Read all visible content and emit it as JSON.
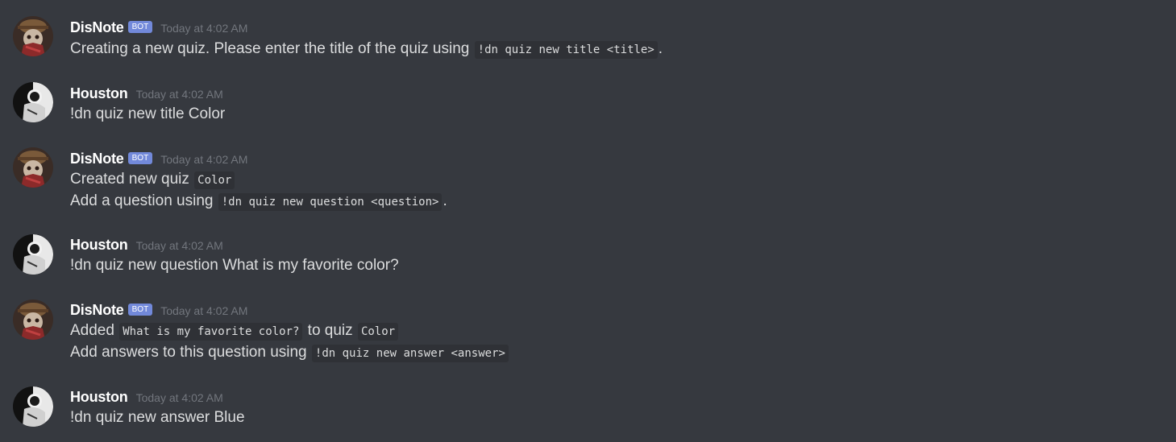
{
  "colors": {
    "background": "#36393f",
    "username": "#ffffff",
    "message_text": "#dcddde",
    "timestamp": "#72767d",
    "bot_badge": "#7289da",
    "code_background": "#2f3136"
  },
  "messages": [
    {
      "author": "DisNote",
      "bot_tag": "BOT",
      "timestamp": "Today at 4:02 AM",
      "line1": {
        "t1": "Creating a new quiz. Please enter the title of the quiz using ",
        "c1": "!dn quiz new title <title>",
        "t2": "."
      }
    },
    {
      "author": "Houston",
      "timestamp": "Today at 4:02 AM",
      "line1": {
        "t1": "!dn quiz new title Color"
      }
    },
    {
      "author": "DisNote",
      "bot_tag": "BOT",
      "timestamp": "Today at 4:02 AM",
      "line1": {
        "t1": "Created new quiz ",
        "c1": "Color"
      },
      "line2": {
        "t1": "Add a question using ",
        "c1": "!dn quiz new question <question>",
        "t2": "."
      }
    },
    {
      "author": "Houston",
      "timestamp": "Today at 4:02 AM",
      "line1": {
        "t1": "!dn quiz new question What is my favorite color?"
      }
    },
    {
      "author": "DisNote",
      "bot_tag": "BOT",
      "timestamp": "Today at 4:02 AM",
      "line1": {
        "t1": "Added ",
        "c1": "What is my favorite color?",
        "t2": " to quiz ",
        "c2": "Color"
      },
      "line2": {
        "t1": "Add answers to this question using ",
        "c1": "!dn quiz new answer <answer>"
      }
    },
    {
      "author": "Houston",
      "timestamp": "Today at 4:02 AM",
      "line1": {
        "t1": "!dn quiz new answer Blue"
      }
    }
  ]
}
